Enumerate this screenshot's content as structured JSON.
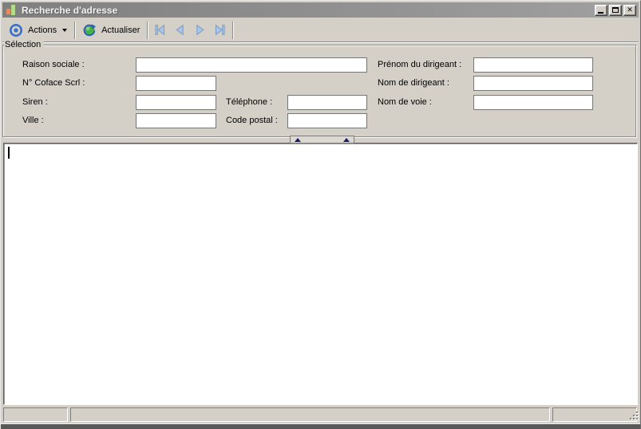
{
  "window": {
    "title": "Recherche d'adresse"
  },
  "toolbar": {
    "actions_label": "Actions",
    "refresh_label": "Actualiser"
  },
  "selection": {
    "title": "Sélection",
    "fields": {
      "raison_sociale": {
        "label": "Raison sociale :",
        "value": ""
      },
      "coface": {
        "label": "N° Coface Scrl :",
        "value": ""
      },
      "siren": {
        "label": "Siren :",
        "value": ""
      },
      "ville": {
        "label": "Ville :",
        "value": ""
      },
      "telephone": {
        "label": "Téléphone :",
        "value": ""
      },
      "code_postal": {
        "label": "Code postal :",
        "value": ""
      },
      "prenom_dirigeant": {
        "label": "Prénom du dirigeant :",
        "value": ""
      },
      "nom_dirigeant": {
        "label": "Nom de dirigeant :",
        "value": ""
      },
      "nom_voie": {
        "label": "Nom de voie :",
        "value": ""
      }
    }
  },
  "results": {
    "content": ""
  },
  "status_bar": {
    "panel_left": "",
    "panel_middle": "",
    "panel_right": ""
  },
  "icons": {
    "window_icon": "bar-chart",
    "actions_icon": "blue-target",
    "refresh_icon": "green-orb-circular-arrows",
    "nav_first_icon": "first-record",
    "nav_prev_icon": "previous-record",
    "nav_next_icon": "next-record",
    "nav_last_icon": "last-record",
    "collapse_icon": "double-up-triangles",
    "minimize_icon": "underscore",
    "maximize_icon": "square",
    "close_icon": "x"
  },
  "colors": {
    "window_background": "#d4d0c8",
    "titlebar_gray": "#8a8a8a",
    "titlebar_text": "#f2f2f2",
    "field_border": "#767676",
    "nav_arrow_blue": "#a9c6e8",
    "actions_blue": "#3a6fc9",
    "refresh_green": "#47b04b",
    "icon_orange": "#ef8a57",
    "icon_green": "#b2dc8a",
    "collapse_arrow_navy": "#1c1c66"
  }
}
